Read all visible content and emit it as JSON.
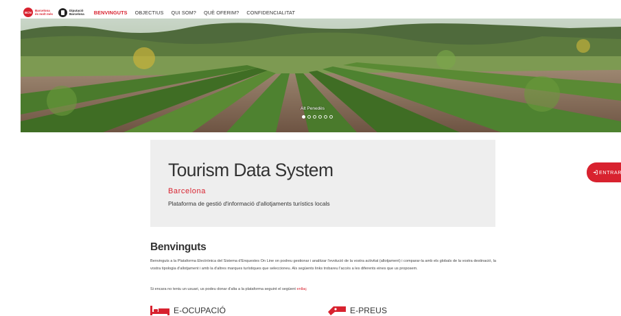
{
  "header": {
    "logo_bcn": {
      "badge": "BCN",
      "line1": "Barcelona",
      "line2": "és molt més"
    },
    "logo_diputacio": {
      "line1": "Diputació",
      "line2": "Barcelona"
    },
    "nav": [
      {
        "label": "BENVINGUTS",
        "active": true
      },
      {
        "label": "OBJECTIUS",
        "active": false
      },
      {
        "label": "QUI SOM?",
        "active": false
      },
      {
        "label": "QUÈ OFERIM?",
        "active": false
      },
      {
        "label": "CONFIDENCIALITAT",
        "active": false
      }
    ]
  },
  "hero": {
    "caption": "Alt Penedès",
    "slide_count": 6,
    "active_slide": 1
  },
  "infobox": {
    "title": "Tourism Data System",
    "subtitle": "Barcelona",
    "description": "Plataforma de gestió d'informació d'allotjaments turístics locals"
  },
  "enter_button": {
    "label": "ENTRAR"
  },
  "welcome": {
    "title": "Benvinguts",
    "text": "Benvinguts a la Plataforma Electrònica del Sistema d'Enquestes On Line on podreu gestionar i analitzar l'evolució de la vostra activitat (allotjament) i comparar-la amb els globals de la vostra destinació, la vostra tipologia d'allotjament i amb la d'altres marques turístiques que seleccioneu. Als següents links trobareu l'accés a les diferents eines que us proposem.",
    "signup_prefix": "Si encara no teniu un usuari, us podeu donar d'alta a la plataforma seguint el següent ",
    "signup_link": "enllaç"
  },
  "modules": [
    {
      "label": "E-OCUPACIÓ",
      "icon": "bed-icon"
    },
    {
      "label": "E-PREUS",
      "icon": "price-tag-icon"
    }
  ],
  "colors": {
    "accent": "#d8222f",
    "panel": "#eeeeee"
  }
}
